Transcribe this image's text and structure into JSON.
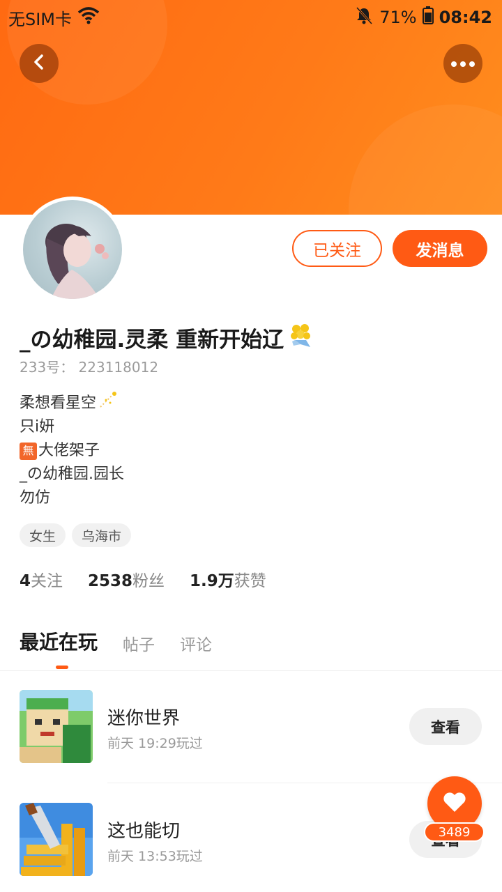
{
  "status_bar": {
    "carrier": "无SIM卡",
    "battery": "71%",
    "time": "08:42"
  },
  "header": {
    "back_icon": "chevron-left-icon",
    "more_icon": "more-dots-icon"
  },
  "actions": {
    "follow_label": "已关注",
    "message_label": "发消息"
  },
  "profile": {
    "username": "_の幼稚园.灵柔 重新开始辽",
    "uid": "233号：  223118012",
    "bio_lines": [
      "柔想看星空",
      "只i妍",
      "大佬架子",
      "_の幼稚园.园长",
      "勿仿"
    ],
    "bio_badge": "無",
    "tags": [
      "女生",
      "乌海市"
    ],
    "stats": {
      "following_num": "4",
      "following_label": "关注",
      "fans_num": "2538",
      "fans_label": "粉丝",
      "likes_num": "1.9万",
      "likes_label": "获赞"
    }
  },
  "tabs": [
    "最近在玩",
    "帖子",
    "评论"
  ],
  "games": [
    {
      "name": "迷你世界",
      "time": "前天 19:29玩过",
      "button": "查看"
    },
    {
      "name": "这也能切",
      "time": "前天 13:53玩过",
      "button": "查看"
    }
  ],
  "like_fab": {
    "count": "3489"
  },
  "colors": {
    "accent": "#ff5a14",
    "header": "#ff7a18"
  }
}
